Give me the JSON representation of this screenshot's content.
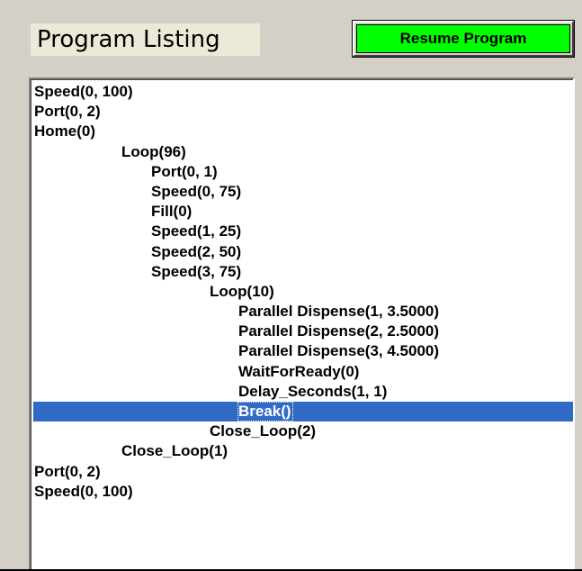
{
  "program_listing": {
    "title": "Program Listing",
    "resume_button_label": "Resume Program",
    "selected_index": 17,
    "lines": [
      {
        "text": "Speed(0, 100)",
        "indent": 0
      },
      {
        "text": "Port(0, 2)",
        "indent": 0
      },
      {
        "text": "Home(0)",
        "indent": 0
      },
      {
        "text": "Loop(96)",
        "indent": 1
      },
      {
        "text": "Port(0, 1)",
        "indent": 2
      },
      {
        "text": "Speed(0, 75)",
        "indent": 2
      },
      {
        "text": "Fill(0)",
        "indent": 2
      },
      {
        "text": "Speed(1, 25)",
        "indent": 2
      },
      {
        "text": "Speed(2, 50)",
        "indent": 2
      },
      {
        "text": "Speed(3, 75)",
        "indent": 2
      },
      {
        "text": "Loop(10)",
        "indent": 3
      },
      {
        "text": "Parallel Dispense(1, 3.5000)",
        "indent": 4
      },
      {
        "text": "Parallel Dispense(2, 2.5000)",
        "indent": 4
      },
      {
        "text": "Parallel Dispense(3, 4.5000)",
        "indent": 4
      },
      {
        "text": "WaitForReady(0)",
        "indent": 4
      },
      {
        "text": "Delay_Seconds(1, 1)",
        "indent": 4
      },
      {
        "text": "Break()",
        "indent": 4
      },
      {
        "text": "Close_Loop(2)",
        "indent": 3
      },
      {
        "text": "Close_Loop(1)",
        "indent": 1
      },
      {
        "text": "Port(0, 2)",
        "indent": 0
      },
      {
        "text": "Speed(0, 100)",
        "indent": 0
      }
    ]
  },
  "colors": {
    "selection": "#316ac5",
    "button_face": "#00ff00",
    "panel": "#d4d0c8"
  }
}
